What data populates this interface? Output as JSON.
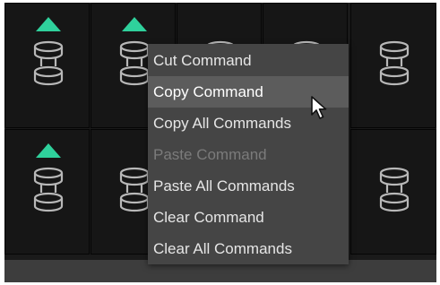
{
  "colors": {
    "accent": "#2fd19c",
    "icon_stroke": "#b8b8b8",
    "menu_bg": "#454545",
    "menu_highlight": "#5c5c5c",
    "disabled_text": "#7b7b7b"
  },
  "grid": {
    "cells": [
      {
        "row": 1,
        "col": 1,
        "has_indicator": true
      },
      {
        "row": 1,
        "col": 2,
        "has_indicator": true
      },
      {
        "row": 1,
        "col": 3,
        "has_indicator": false
      },
      {
        "row": 1,
        "col": 4,
        "has_indicator": false
      },
      {
        "row": 1,
        "col": 5,
        "has_indicator": false
      },
      {
        "row": 2,
        "col": 1,
        "has_indicator": true
      },
      {
        "row": 2,
        "col": 2,
        "has_indicator": false
      },
      {
        "row": 2,
        "col": 3,
        "has_indicator": false
      },
      {
        "row": 2,
        "col": 4,
        "has_indicator": false
      },
      {
        "row": 2,
        "col": 5,
        "has_indicator": false
      }
    ],
    "indicator_icon": "triangle-up-icon",
    "slot_icon": "stack-slot-icon"
  },
  "context_menu": {
    "items": [
      {
        "label": "Cut Command",
        "state": "normal"
      },
      {
        "label": "Copy Command",
        "state": "highlighted"
      },
      {
        "label": "Copy All Commands",
        "state": "normal"
      },
      {
        "label": "Paste Command",
        "state": "disabled"
      },
      {
        "label": "Paste All Commands",
        "state": "normal"
      },
      {
        "label": "Clear Command",
        "state": "normal"
      },
      {
        "label": "Clear All Commands",
        "state": "normal"
      }
    ]
  },
  "cursor": {
    "icon": "arrow-cursor-icon"
  }
}
